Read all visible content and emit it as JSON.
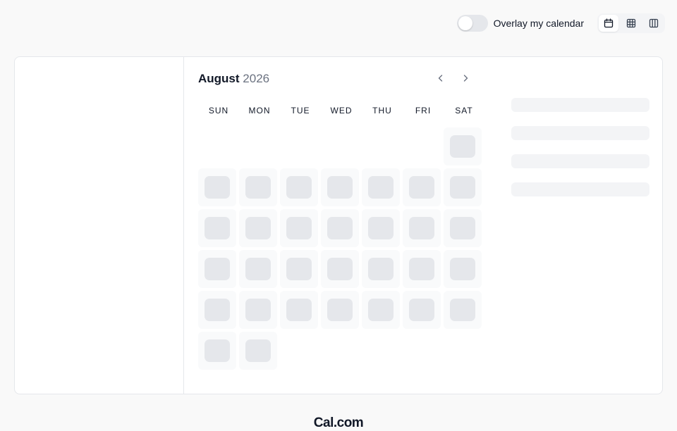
{
  "overlay_toggle": {
    "label": "Overlay my calendar",
    "enabled": false
  },
  "view_switch": {
    "options": [
      {
        "icon": "calendar-icon",
        "active": true
      },
      {
        "icon": "grid-icon",
        "active": false
      },
      {
        "icon": "columns-icon",
        "active": false
      }
    ]
  },
  "calendar": {
    "month": "August",
    "year": "2026",
    "weekdays": [
      "SUN",
      "MON",
      "TUE",
      "WED",
      "THU",
      "FRI",
      "SAT"
    ],
    "first_weekday_index": 6,
    "days_in_month": 31,
    "loading": true
  },
  "time_slots": {
    "loading": true,
    "placeholder_count": 4
  },
  "footer": {
    "brand": "Cal.com"
  }
}
